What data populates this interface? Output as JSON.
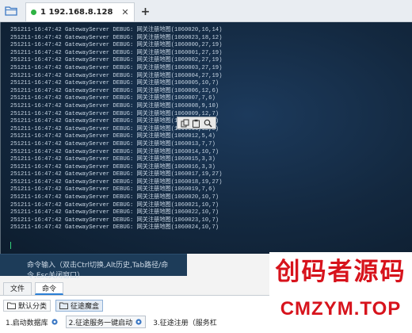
{
  "tabbar": {
    "tab_label": "1  192.168.8.128",
    "close_glyph": "✕",
    "add_glyph": "+",
    "status_color": "#2fb344"
  },
  "terminal": {
    "lines": [
      "251211-16:47:42 GatewayServer DEBUG: 网关注册地图(1060020,16,14)",
      "251211-16:47:42 GatewayServer DEBUG: 网关注册地图(1060023,18,12)",
      "251211-16:47:42 GatewayServer DEBUG: 网关注册地图(1060000,27,19)",
      "251211-16:47:42 GatewayServer DEBUG: 网关注册地图(1060001,27,19)",
      "251211-16:47:42 GatewayServer DEBUG: 网关注册地图(1060002,27,19)",
      "251211-16:47:42 GatewayServer DEBUG: 网关注册地图(1060003,27,19)",
      "251211-16:47:42 GatewayServer DEBUG: 网关注册地图(1060004,27,19)",
      "251211-16:47:42 GatewayServer DEBUG: 网关注册地图(1060005,10,7)",
      "251211-16:47:42 GatewayServer DEBUG: 网关注册地图(1060006,12,6)",
      "251211-16:47:42 GatewayServer DEBUG: 网关注册地图(1060007,7,6)",
      "251211-16:47:42 GatewayServer DEBUG: 网关注册地图(1060008,9,10)",
      "251211-16:47:42 GatewayServer DEBUG: 网关注册地图(1060009,12,7)",
      "251211-16:47:42 GatewayServer DEBUG: 网关注册地图(1060010,12,7)",
      "251211-16:47:42 GatewayServer DEBUG: 网关注册地图(1060011,12,8)",
      "251211-16:47:42 GatewayServer DEBUG: 网关注册地图(1060012,5,4)",
      "251211-16:47:42 GatewayServer DEBUG: 网关注册地图(1060013,7,7)",
      "251211-16:47:42 GatewayServer DEBUG: 网关注册地图(1060014,10,7)",
      "251211-16:47:42 GatewayServer DEBUG: 网关注册地图(1060015,3,3)",
      "251211-16:47:42 GatewayServer DEBUG: 网关注册地图(1060016,3,3)",
      "251211-16:47:42 GatewayServer DEBUG: 网关注册地图(1060017,19,27)",
      "251211-16:47:42 GatewayServer DEBUG: 网关注册地图(1060018,19,27)",
      "251211-16:47:42 GatewayServer DEBUG: 网关注册地图(1060019,7,6)",
      "251211-16:47:42 GatewayServer DEBUG: 网关注册地图(1060020,10,7)",
      "251211-16:47:42 GatewayServer DEBUG: 网关注册地图(1060021,10,7)",
      "251211-16:47:42 GatewayServer DEBUG: 网关注册地图(1060022,10,7)",
      "251211-16:47:42 GatewayServer DEBUG: 网关注册地图(1060023,10,7)",
      "251211-16:47:42 GatewayServer DEBUG: 网关注册地图(1060024,10,7)"
    ],
    "floating_toolbar_icons": [
      "copy-icon",
      "paste-icon",
      "search-icon"
    ]
  },
  "command_bar": {
    "placeholder": "命令输入（双击Ctrl切换,Alt历史,Tab路径/命令,Esc关闭窗口）"
  },
  "bottom": {
    "tabs": [
      "文件",
      "命令"
    ],
    "active_tab": "命令",
    "categories": [
      "默认分类",
      "征途魔盒"
    ],
    "commands": [
      "1.启动数据库",
      "2.征途服务一键启动",
      "3.征途注册（服务杠"
    ]
  },
  "watermark": {
    "title": "创码者源码",
    "url": "CMZYM.TOP"
  },
  "colors": {
    "terminal_bg": "#13283f",
    "accent": "#2b7fd6",
    "watermark": "#d7131c"
  }
}
